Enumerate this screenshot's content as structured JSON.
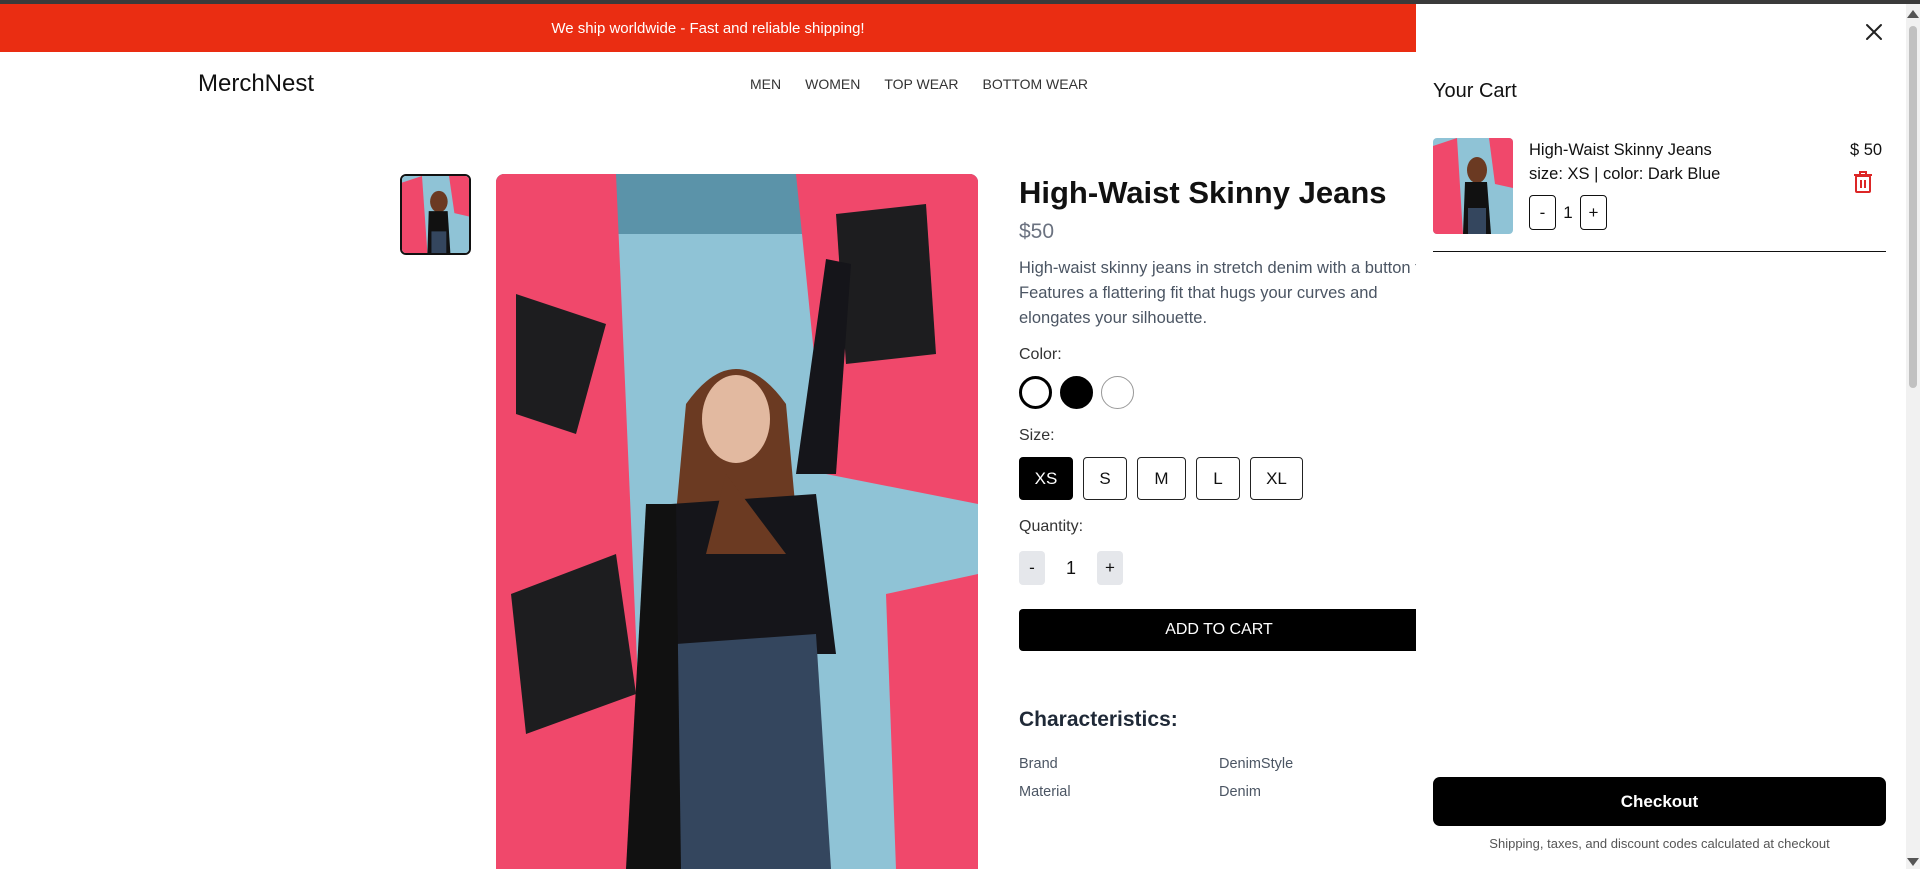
{
  "banner": {
    "text": "We ship worldwide - Fast and reliable shipping!"
  },
  "header": {
    "logo": "MerchNest",
    "nav": [
      "MEN",
      "WOMEN",
      "TOP WEAR",
      "BOTTOM WEAR"
    ]
  },
  "product": {
    "title": "High-Waist Skinny Jeans",
    "price": "$50",
    "description": "High-waist skinny jeans in stretch denim with a button fly. Features a flattering fit that hugs your curves and elongates your silhouette.",
    "color_label": "Color:",
    "colors": [
      "#ffffff",
      "#000000",
      "#ffffff"
    ],
    "size_label": "Size:",
    "sizes": [
      "XS",
      "S",
      "M",
      "L",
      "XL"
    ],
    "selected_size": "XS",
    "quantity_label": "Quantity:",
    "quantity": "1",
    "minus": "-",
    "plus": "+",
    "add_to_cart": "ADD TO CART",
    "characteristics_title": "Characteristics:",
    "characteristics": [
      {
        "key": "Brand",
        "value": "DenimStyle"
      },
      {
        "key": "Material",
        "value": "Denim"
      }
    ]
  },
  "cart": {
    "title": "Your Cart",
    "close_icon": "close-icon",
    "item": {
      "name": "High-Waist Skinny Jeans",
      "meta": "size: XS | color: Dark Blue",
      "price": "$ 50",
      "quantity": "1",
      "minus": "-",
      "plus": "+",
      "delete_icon": "trash-icon"
    },
    "checkout": "Checkout",
    "note": "Shipping, taxes, and discount codes calculated at checkout"
  },
  "colors": {
    "banner": "#ea2d12",
    "primary": "#000000",
    "trash": "#dc2626"
  }
}
